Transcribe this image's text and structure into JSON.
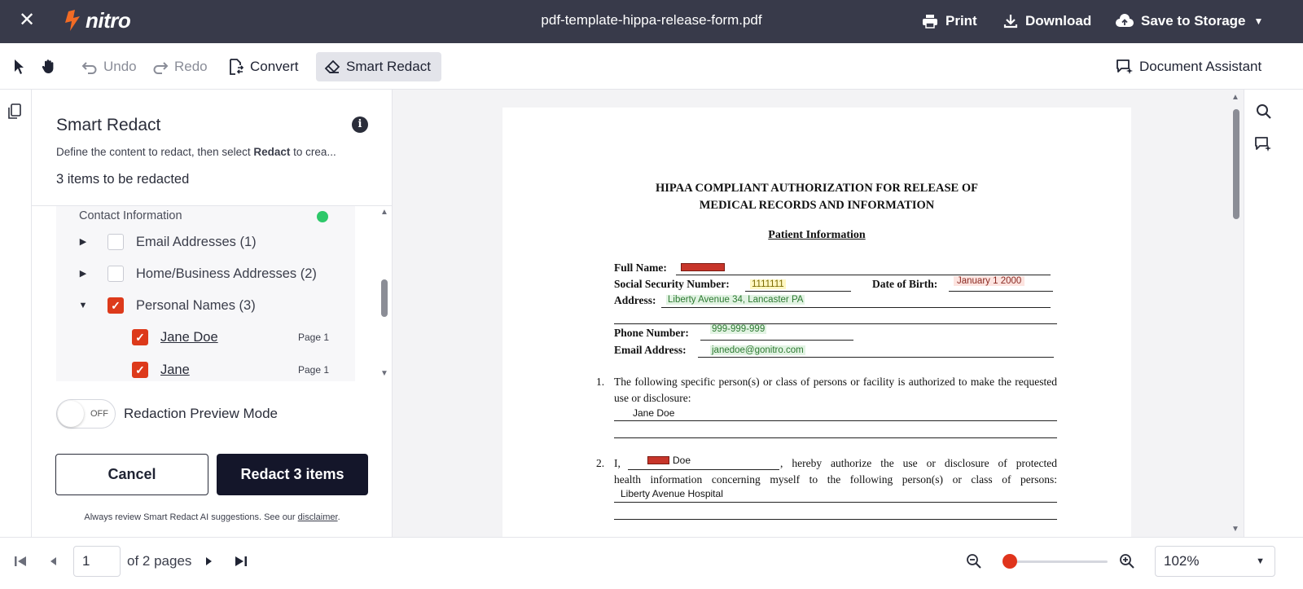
{
  "topbar": {
    "close_icon": "close-icon",
    "brand": "nitro",
    "filename": "pdf-template-hippa-release-form.pdf",
    "print": "Print",
    "download": "Download",
    "save_to_storage": "Save to Storage"
  },
  "toolbar": {
    "undo": "Undo",
    "redo": "Redo",
    "convert": "Convert",
    "smart_redact": "Smart Redact",
    "document_assistant": "Document Assistant"
  },
  "panel": {
    "title": "Smart Redact",
    "description_prefix": "Define the content to redact, then select ",
    "description_bold": "Redact",
    "description_suffix": " to crea...",
    "items_count": "3 items to be redacted",
    "category": "Contact Information",
    "rows": [
      {
        "label": "Email Addresses (1)",
        "expanded": false,
        "checked": false
      },
      {
        "label": "Home/Business Addresses (2)",
        "expanded": false,
        "checked": false
      },
      {
        "label": "Personal Names (3)",
        "expanded": true,
        "checked": true
      }
    ],
    "subrows": [
      {
        "label": "Jane Doe",
        "page": "Page 1",
        "checked": true
      },
      {
        "label": "Jane",
        "page": "Page 1",
        "checked": true
      }
    ],
    "toggle_state": "OFF",
    "preview_label": "Redaction Preview Mode",
    "cancel": "Cancel",
    "redact": "Redact 3 items",
    "footnote_prefix": "Always review Smart Redact AI suggestions. See our ",
    "footnote_link": "disclaimer",
    "footnote_suffix": "."
  },
  "document": {
    "title_line1": "HIPAA COMPLIANT AUTHORIZATION FOR RELEASE OF",
    "title_line2": "MEDICAL RECORDS AND INFORMATION",
    "section": "Patient Information",
    "full_name_label": "Full Name:",
    "ssn_label": "Social Security Number:",
    "ssn_value": "1111111",
    "dob_label": "Date of Birth:",
    "dob_value": "January 1 2000",
    "address_label": "Address:",
    "address_value": "Liberty Avenue 34, Lancaster PA",
    "phone_label": "Phone Number:",
    "phone_value": "999-999-999",
    "email_label": "Email Address:",
    "email_value": "janedoe@gonitro.com",
    "item1_num": "1.",
    "item1_text": "The following specific person(s) or class of persons or facility is authorized to make the requested use or disclosure:",
    "item1_value": "Jane Doe",
    "item2_num": "2.",
    "item2_i": "I,",
    "item2_value": "Doe",
    "item2_text1": ", hereby authorize the use or disclosure of protected",
    "item2_text2": "health information concerning myself to the following person(s) or class of persons:",
    "item2_value2": "Liberty Avenue Hospital"
  },
  "bottombar": {
    "page_current": "1",
    "page_of": "of 2 pages",
    "zoom_value": "102%",
    "zoom_level": 0.0
  },
  "colors": {
    "topbar_bg": "#383a4a",
    "accent": "#dd3a1b",
    "primary_button": "#14162a",
    "status_dot": "#2ec86a"
  }
}
